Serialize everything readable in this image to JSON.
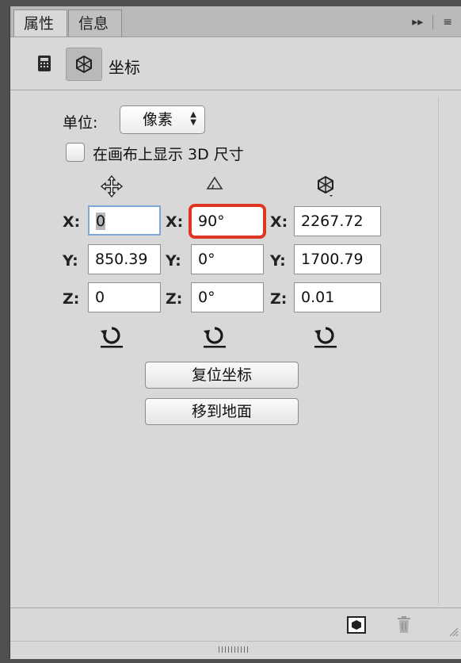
{
  "tabs": [
    {
      "label": "属性",
      "active": true
    },
    {
      "label": "信息",
      "active": false
    }
  ],
  "header_controls": {
    "collapse_glyph": "▸▸",
    "menu_glyph": "≡"
  },
  "toolbar": {
    "icons": [
      "calculator-icon",
      "3d-coordinates-icon"
    ],
    "title": "坐标"
  },
  "units": {
    "label": "单位:",
    "selected": "像素"
  },
  "show_3d_size": {
    "label": "在画布上显示 3D 尺寸",
    "checked": false
  },
  "columns": [
    {
      "icon": "move-icon",
      "fields": [
        {
          "axis": "X:",
          "value": "0"
        },
        {
          "axis": "Y:",
          "value": "850.39"
        },
        {
          "axis": "Z:",
          "value": "0"
        }
      ]
    },
    {
      "icon": "rotate-angle-icon",
      "fields": [
        {
          "axis": "X:",
          "value": "90°"
        },
        {
          "axis": "Y:",
          "value": "0°"
        },
        {
          "axis": "Z:",
          "value": "0°"
        }
      ]
    },
    {
      "icon": "scale-3d-icon",
      "fields": [
        {
          "axis": "X:",
          "value": "2267.72"
        },
        {
          "axis": "Y:",
          "value": "1700.79"
        },
        {
          "axis": "Z:",
          "value": "0.01"
        }
      ]
    }
  ],
  "buttons": {
    "reset_coordinates": "复位坐标",
    "move_to_ground": "移到地面"
  },
  "footer_icons": [
    "cube-icon",
    "trash-icon"
  ],
  "colors": {
    "panel_bg": "#d8d8d8",
    "highlight": "#e0361f",
    "focus": "#7fa7d6"
  }
}
